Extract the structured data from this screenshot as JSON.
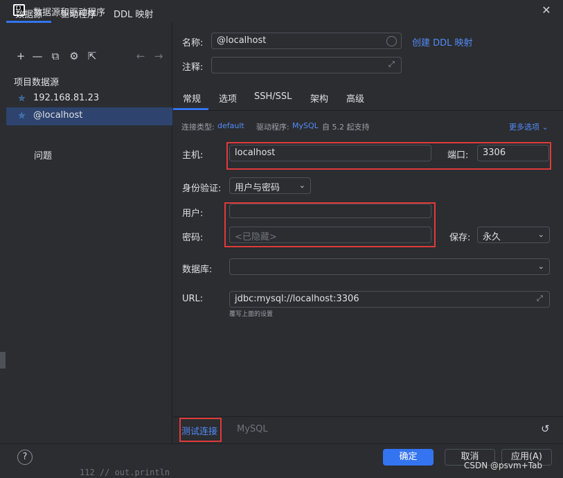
{
  "window": {
    "title": "数据源和驱动程序",
    "logo_text": "IJ",
    "close": "✕"
  },
  "left": {
    "tabs": [
      "数据源",
      "驱动程序",
      "DDL 映射"
    ],
    "toolbar_icons": [
      "+",
      "—",
      "⧉",
      "⚙",
      "⇱",
      "←",
      "→"
    ],
    "section_label": "项目数据源",
    "datasources": [
      {
        "label": "192.168.81.23"
      },
      {
        "label": "@localhost"
      }
    ],
    "problems_label": "问题"
  },
  "right": {
    "name_label": "名称:",
    "name_value": "@localhost",
    "create_ddl_link": "创建 DDL 映射",
    "comment_label": "注释:",
    "tabs": [
      "常规",
      "选项",
      "SSH/SSL",
      "架构",
      "高级"
    ],
    "conn_type_label": "连接类型:",
    "conn_type_value": "default",
    "driver_label": "驱动程序:",
    "driver_value": "MySQL",
    "driver_note": "自 5.2 起支持",
    "more_options": "更多选项",
    "host_label": "主机:",
    "host_value": "localhost",
    "port_label": "端口:",
    "port_value": "3306",
    "auth_label": "身份验证:",
    "auth_value": "用户与密码",
    "user_label": "用户:",
    "user_value": "",
    "password_label": "密码:",
    "password_placeholder": "<已隐藏>",
    "save_label": "保存:",
    "save_value": "永久",
    "database_label": "数据库:",
    "database_value": "",
    "url_label": "URL:",
    "url_value": "jdbc:mysql://localhost:3306",
    "url_hint": "覆写上面的设置",
    "test_connection": "测试连接",
    "driver_footer": "MySQL",
    "reset_icon": "↺"
  },
  "footer": {
    "help": "?",
    "ok": "确定",
    "cancel": "取消",
    "apply": "应用(A)"
  },
  "watermark": "CSDN @psvm+Tab",
  "background_code": "112  //        out.println",
  "colors": {
    "accent": "#3574f0",
    "highlight_box": "#e03a3a",
    "link": "#548af7",
    "selected_row": "#2e436e"
  }
}
